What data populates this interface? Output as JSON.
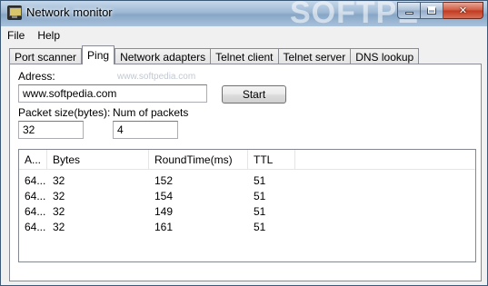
{
  "window": {
    "title": "Network monitor"
  },
  "watermark": {
    "brand": "SOFTPE",
    "url": "www.softpedia.com"
  },
  "menu": {
    "items": [
      "File",
      "Help"
    ]
  },
  "tabs": [
    "Port scanner",
    "Ping",
    "Network adapters",
    "Telnet client",
    "Telnet server",
    "DNS lookup"
  ],
  "active_tab": "Ping",
  "ping": {
    "address_label": "Adress:",
    "address_value": "www.softpedia.com",
    "start_label": "Start",
    "packet_size_label": "Packet size(bytes):",
    "packet_size_value": "32",
    "num_packets_label": "Num of packets",
    "num_packets_value": "4"
  },
  "results": {
    "columns": [
      "A...",
      "Bytes",
      "RoundTime(ms)",
      "TTL",
      ""
    ],
    "rows": [
      [
        "64...",
        "32",
        "152",
        "51"
      ],
      [
        "64...",
        "32",
        "154",
        "51"
      ],
      [
        "64...",
        "32",
        "149",
        "51"
      ],
      [
        "64...",
        "32",
        "161",
        "51"
      ]
    ]
  }
}
